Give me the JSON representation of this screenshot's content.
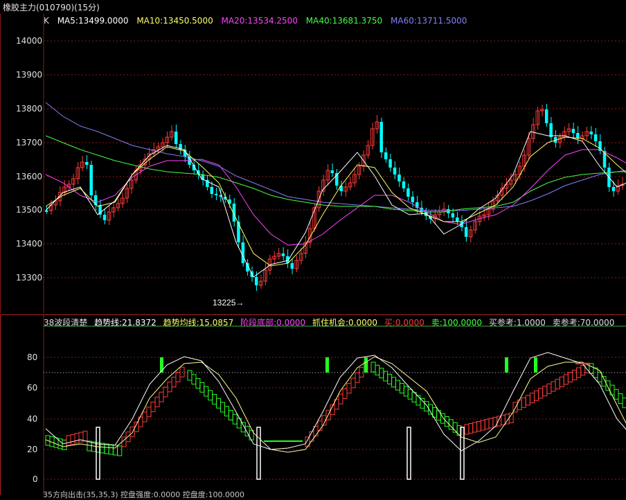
{
  "title": "橡胶主力(010790)(15分)",
  "ma_legend": {
    "k": "K",
    "ma5": "MA5:13499.0000",
    "ma10": "MA10:13450.5000",
    "ma20": "MA20:13534.2500",
    "ma40": "MA40:13681.3750",
    "ma60": "MA60:13711.5000"
  },
  "k_axis_labels": [
    "14000",
    "13900",
    "13800",
    "13700",
    "13600",
    "13500",
    "13400",
    "13300"
  ],
  "low_marker": "13225→",
  "indicator_legend": {
    "name": "38波段清楚",
    "trend": "趋势线:21.8372",
    "trend_avg": "趋势均线:15.0857",
    "stage_bottom": "阶段底部:0.0000",
    "catch": "抓住机会:0.0000",
    "buy": "买:0.0000",
    "sell": "卖:100.0000",
    "buy_ref": "买参考:1.0000",
    "sell_ref": "卖参考:70.0000"
  },
  "indicator_axis_labels": [
    "80",
    "60",
    "40",
    "20",
    "0"
  ],
  "bottom_strip": "35方向出击(35,35,3) 控盘强度:0.0000 控盘度:100.0000",
  "colors": {
    "up": "#ff3b3b",
    "down": "#00ffff",
    "ma5": "#ffffff",
    "ma10": "#ffff66",
    "ma20": "#ff44ff",
    "ma40": "#44ff44",
    "ma60": "#8080ff",
    "grid": "#8b1a1a",
    "green_mark": "#22ff22"
  }
}
